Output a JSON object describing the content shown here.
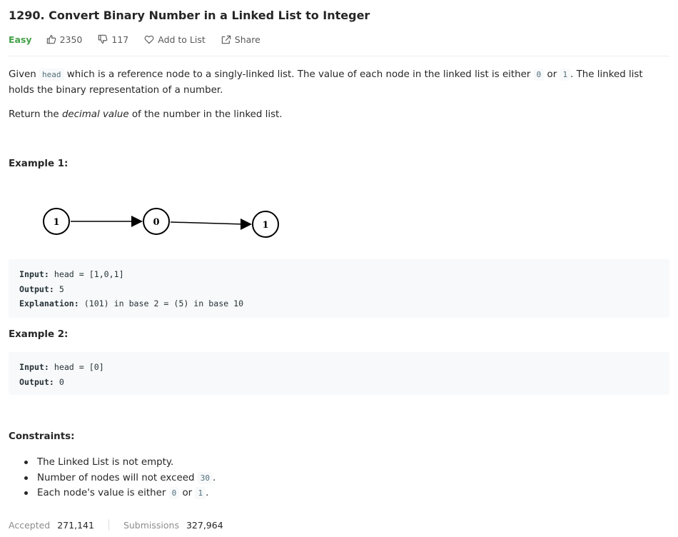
{
  "problem": {
    "title": "1290. Convert Binary Number in a Linked List to Integer",
    "difficulty": "Easy",
    "likes": "2350",
    "dislikes": "117",
    "add_to_list": "Add to List",
    "share": "Share",
    "accent_easy": "#43a047"
  },
  "description": {
    "p1_a": "Given ",
    "p1_code_head": "head",
    "p1_b": " which is a reference node to a singly-linked list. The value of each node in the linked list is either ",
    "p1_code_0": "0",
    "p1_c": " or ",
    "p1_code_1": "1",
    "p1_d": ". The linked list holds the binary representation of a number.",
    "p2_a": "Return the ",
    "p2_em": "decimal value",
    "p2_b": " of the number in the linked list."
  },
  "example1": {
    "heading": "Example 1:",
    "nodes": [
      "1",
      "0",
      "1"
    ],
    "input_label": "Input:",
    "input_value": " head = [1,0,1]",
    "output_label": "Output:",
    "output_value": " 5",
    "explanation_label": "Explanation:",
    "explanation_value": " (101) in base 2 = (5) in base 10"
  },
  "example2": {
    "heading": "Example 2:",
    "input_label": "Input:",
    "input_value": " head = [0]",
    "output_label": "Output:",
    "output_value": " 0"
  },
  "constraints": {
    "heading": "Constraints:",
    "c1": "The Linked List is not empty.",
    "c2_a": "Number of nodes will not exceed ",
    "c2_code": "30",
    "c2_b": ".",
    "c3_a": "Each node's value is either ",
    "c3_code_0": "0",
    "c3_or": " or ",
    "c3_code_1": "1",
    "c3_b": "."
  },
  "stats": {
    "accepted_label": "Accepted",
    "accepted_value": "271,141",
    "submissions_label": "Submissions",
    "submissions_value": "327,964"
  }
}
